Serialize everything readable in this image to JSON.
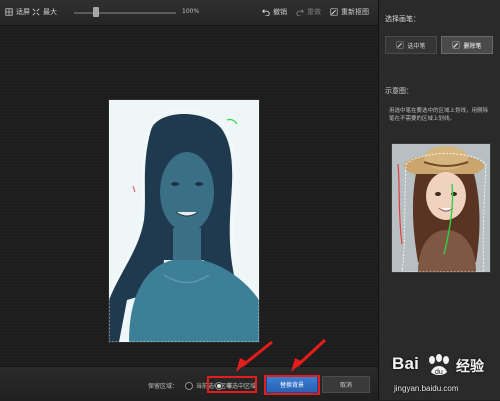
{
  "toolbar": {
    "fit_label": "适屏",
    "max_label": "最大",
    "zoom_percent": "100%",
    "zoom_level": 0.22,
    "undo_label": "撤销",
    "redo_label": "重做",
    "redraw_label": "重新抠图"
  },
  "panel": {
    "title": "选择画笔：",
    "brush_select_label": "选中笔",
    "brush_delete_label": "删除笔",
    "example_title": "示意图：",
    "example_desc": "用选中笔在要选中的区域上划线，用删除笔在不需要的区域上划线。"
  },
  "bottom": {
    "keep_label": "保留区域：",
    "option_current": "当前选中区域",
    "option_non": "非选中区域",
    "replace_button": "替换背景",
    "cancel_button": "取消"
  },
  "watermark": {
    "brand": "Bai",
    "brand_suffix": "经验",
    "url": "jingyan.baidu.com"
  },
  "colors": {
    "highlight": "#e31c1c",
    "primary": "#2f6fc8",
    "selection_overlay": "#2d6f8a"
  }
}
